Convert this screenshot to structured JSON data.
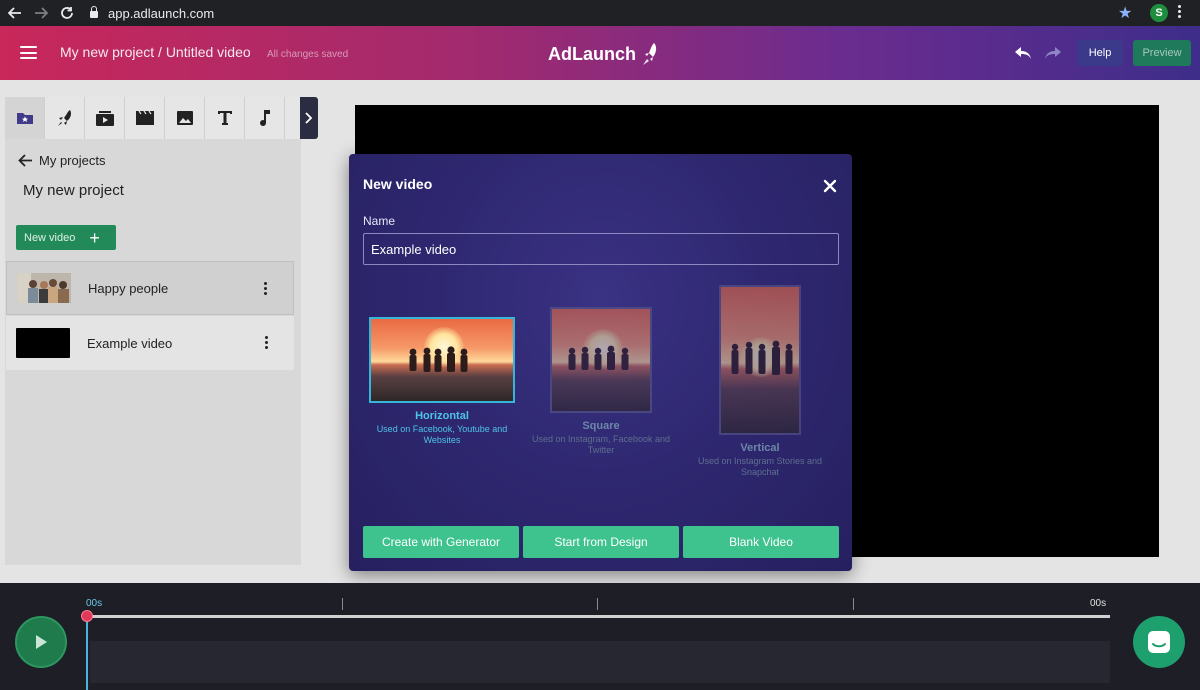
{
  "browser": {
    "url": "app.adlaunch.com",
    "profile_initial": "S"
  },
  "header": {
    "project_title": "My new project / Untitled video",
    "save_status": "All changes saved",
    "logo_text": "AdLaunch",
    "help_label": "Help",
    "preview_label": "Preview"
  },
  "sidebar": {
    "tools": [
      "folder-star-icon",
      "rocket-icon",
      "media-icon",
      "film-icon",
      "image-icon",
      "text-icon",
      "music-icon"
    ],
    "back_label": "My projects",
    "project_name": "My new project",
    "new_video_label": "New video",
    "videos": [
      {
        "label": "Happy people",
        "thumb": "photo"
      },
      {
        "label": "Example video",
        "thumb": "black"
      }
    ]
  },
  "modal": {
    "title": "New video",
    "name_label": "Name",
    "name_value": "Example video",
    "formats": [
      {
        "title": "Horizontal",
        "desc": "Used on Facebook, Youtube and Websites",
        "selected": true
      },
      {
        "title": "Square",
        "desc": "Used on Instagram, Facebook and Twitter",
        "selected": false
      },
      {
        "title": "Vertical",
        "desc": "Used on Instagram Stories and Snapchat",
        "selected": false
      }
    ],
    "buttons": {
      "generator": "Create with Generator",
      "design": "Start from Design",
      "blank": "Blank Video"
    }
  },
  "timeline": {
    "start_time": "00s",
    "end_time": "00s"
  },
  "colors": {
    "accent_green": "#3ec38f",
    "selection_blue": "#35b5d9",
    "header_start": "#c8285a",
    "header_end": "#3e2d8a"
  }
}
